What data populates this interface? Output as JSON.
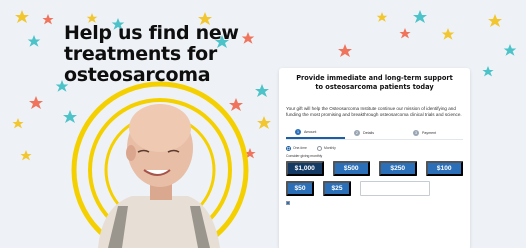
{
  "hero": {
    "headline_line1": "Help us find new",
    "headline_line2": "treatments for",
    "headline_line3": "osteosarcoma",
    "colors": {
      "background": "#eef2f6",
      "ring_yellow": "#f5d000",
      "star_teal": "#4cc3c9",
      "star_coral": "#f0735c",
      "star_yellow": "#f2c62e"
    }
  },
  "donation_card": {
    "title_line1": "Provide immediate and long-term support",
    "title_line2": "to osteosarcoma patients today",
    "body": "Your gift will help the Osteosarcoma Institute continue our mission of identifying and funding the most promising and breakthrough osteosarcoma clinical trials and science.",
    "steps": [
      {
        "number": "1",
        "label": "Amount"
      },
      {
        "number": "2",
        "label": "Details"
      },
      {
        "number": "3",
        "label": "Payment"
      }
    ],
    "frequency": {
      "options": [
        "One-time",
        "Monthly"
      ],
      "selected": "One-time"
    },
    "consider_label": "Consider giving monthly",
    "amounts": [
      "$1,000",
      "$500",
      "$250",
      "$100",
      "$50",
      "$25"
    ],
    "selected_amount": "$1,000",
    "accent_color": "#2a6fb8",
    "selected_color": "#143a66"
  }
}
